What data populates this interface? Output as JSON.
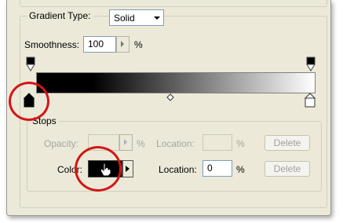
{
  "gradient_type": {
    "label": "Gradient Type:",
    "value": "Solid"
  },
  "smoothness": {
    "label": "Smoothness:",
    "value": "100",
    "unit": "%"
  },
  "stops": {
    "title": "Stops",
    "opacity": {
      "label": "Opacity:",
      "value": "",
      "unit": "%"
    },
    "opacity_location": {
      "label": "Location:",
      "value": "",
      "unit": "%"
    },
    "opacity_delete": "Delete",
    "color": {
      "label": "Color:",
      "swatch_color": "#000000"
    },
    "color_location": {
      "label": "Location:",
      "value": "0",
      "unit": "%"
    },
    "color_delete": "Delete"
  },
  "highlight_color": "#d41515"
}
